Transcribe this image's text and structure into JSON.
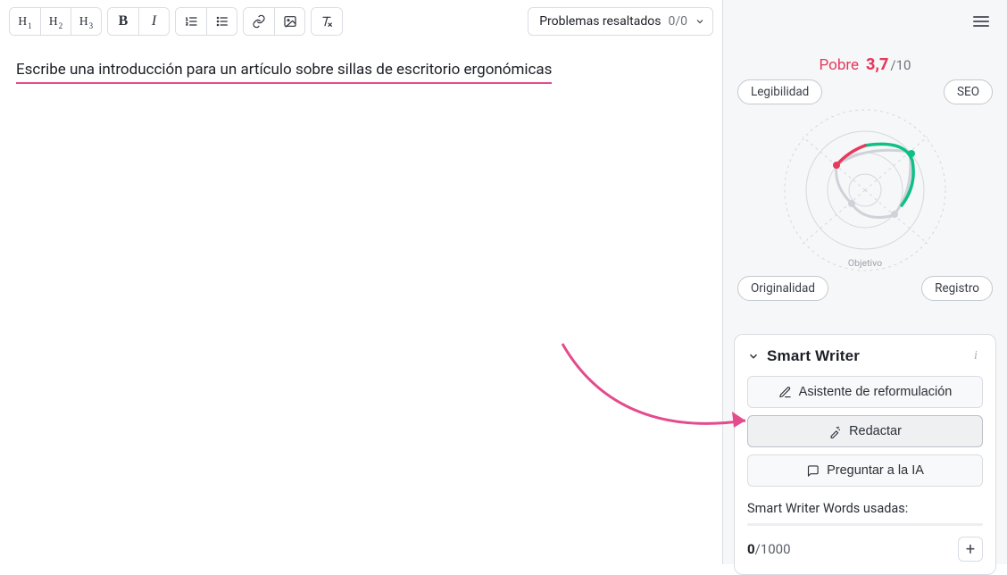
{
  "toolbar": {
    "h1": "H",
    "h1s": "1",
    "h2": "H",
    "h2s": "2",
    "h3": "H",
    "h3s": "3",
    "bold": "B",
    "italic": "I",
    "problems_label": "Problemas resaltados",
    "problems_count": "0/0"
  },
  "editor": {
    "content": "Escribe una introducción para un artículo sobre sillas de escritorio ergonómicas"
  },
  "score": {
    "rating": "Pobre",
    "value": "3,7",
    "out_of": "/10"
  },
  "radar": {
    "labels": {
      "tl": "Legibilidad",
      "tr": "SEO",
      "bl": "Originalidad",
      "br": "Registro"
    },
    "objective": "Objetivo"
  },
  "smart_writer": {
    "title": "Smart Writer",
    "btn_reformulate": "Asistente de reformulación",
    "btn_write": "Redactar",
    "btn_ask": "Preguntar a la IA",
    "usage_label": "Smart Writer Words usadas:",
    "usage_count": "0",
    "usage_of": "/1000"
  }
}
